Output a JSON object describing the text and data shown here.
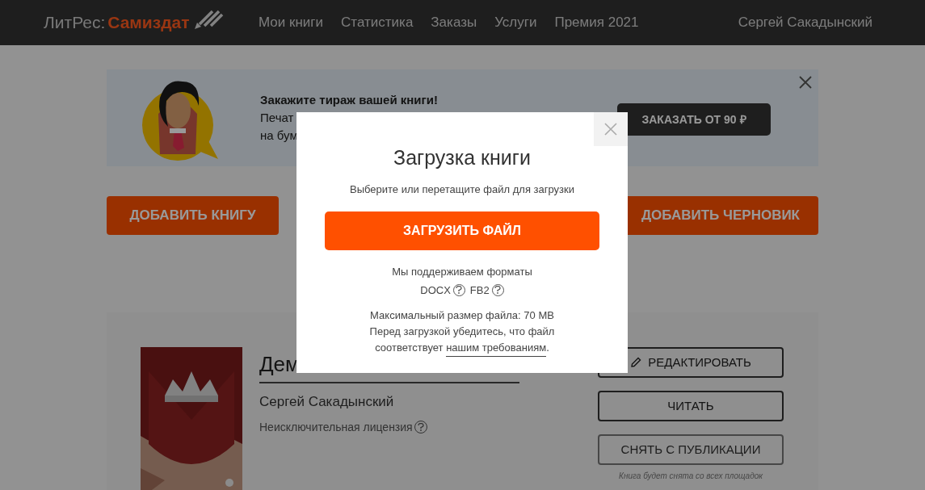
{
  "header": {
    "logo": {
      "brand": "ЛитРес:",
      "product": "Самиздат"
    },
    "nav": [
      {
        "label": "Мои книги"
      },
      {
        "label": "Статистика"
      },
      {
        "label": "Заказы"
      },
      {
        "label": "Услуги"
      },
      {
        "label": "Премия 2021"
      }
    ],
    "user": "Сергей Сакадынский"
  },
  "banner": {
    "title": "Закажите тираж вашей книги!",
    "lines": [
      "Печат",
      "на бум"
    ],
    "button": "ЗАКАЗАТЬ ОТ 90 ₽"
  },
  "actions": [
    "ДОБАВИТЬ КНИГУ",
    "ДОБАВИТЬ ЧЕРНОВИК"
  ],
  "book": {
    "title": "Дем",
    "author": "Сергей Сакадынский",
    "license": "Неисключительная лицензия",
    "buttons": [
      {
        "kind": "edit",
        "label": "РЕДАКТИРОВАТЬ"
      },
      {
        "kind": "plain",
        "label": "ЧИТАТЬ"
      },
      {
        "kind": "muted",
        "label": "СНЯТЬ С ПУБЛИКАЦИИ"
      }
    ],
    "note": "Книга будет снята со всех площадок"
  },
  "modal": {
    "title": "Загрузка книги",
    "subtitle": "Выберите или перетащите файл для загрузки",
    "button": "ЗАГРУЗИТЬ ФАЙЛ",
    "formats_label": "Мы поддерживаем форматы",
    "formats": [
      "DOCX",
      "FB2"
    ],
    "max_size": "Максимальный размер файла: 70 MB",
    "check_line": "Перед загрузкой убедитесь, что файл",
    "requirements_prefix": "соответствует",
    "requirements_link": "нашим требованиям",
    "requirements_suffix": "."
  }
}
